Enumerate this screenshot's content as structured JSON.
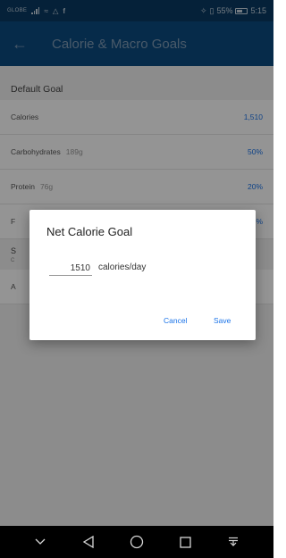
{
  "status_bar": {
    "carrier": "GLOBE",
    "battery": "55%",
    "time": "5:15"
  },
  "app_bar": {
    "title": "Calorie & Macro Goals",
    "back_icon": "arrow-left-icon"
  },
  "default_goal": {
    "header": "Default Goal",
    "rows": [
      {
        "label": "Calories",
        "sub": "",
        "value": "1,510"
      },
      {
        "label": "Carbohydrates",
        "sub": "189g",
        "value": "50%"
      },
      {
        "label": "Protein",
        "sub": "76g",
        "value": "20%"
      },
      {
        "label": "F",
        "sub": "",
        "value": "%"
      }
    ]
  },
  "section2": {
    "title": "S",
    "subtitle": "C"
  },
  "section3": {
    "label": "A"
  },
  "dialog": {
    "title": "Net Calorie Goal",
    "input_value": "1510",
    "unit": "calories/day",
    "cancel": "Cancel",
    "save": "Save"
  },
  "colors": {
    "accent": "#1a73e8",
    "app_bar": "#0b4a80",
    "status_bar": "#093a62"
  }
}
